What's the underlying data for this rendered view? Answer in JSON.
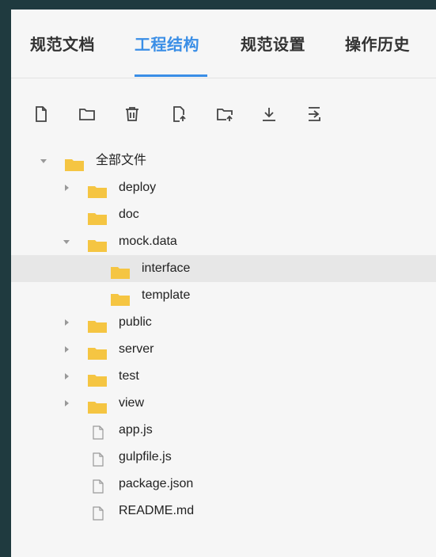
{
  "tabs": [
    {
      "label": "规范文档",
      "active": false
    },
    {
      "label": "工程结构",
      "active": true
    },
    {
      "label": "规范设置",
      "active": false
    },
    {
      "label": "操作历史",
      "active": false
    }
  ],
  "toolbar": [
    {
      "icon": "new-file-icon"
    },
    {
      "icon": "new-folder-icon"
    },
    {
      "icon": "delete-icon"
    },
    {
      "icon": "upload-file-icon"
    },
    {
      "icon": "upload-folder-icon"
    },
    {
      "icon": "download-icon"
    },
    {
      "icon": "export-icon"
    }
  ],
  "tree": {
    "root": {
      "label": "全部文件",
      "expanded": true
    },
    "items": [
      {
        "label": "deploy",
        "type": "folder",
        "expanded": false
      },
      {
        "label": "doc",
        "type": "folder",
        "expanded": null
      },
      {
        "label": "mock.data",
        "type": "folder",
        "expanded": true,
        "children": [
          {
            "label": "interface",
            "type": "folder",
            "selected": true
          },
          {
            "label": "template",
            "type": "folder"
          }
        ]
      },
      {
        "label": "public",
        "type": "folder",
        "expanded": false
      },
      {
        "label": "server",
        "type": "folder",
        "expanded": false
      },
      {
        "label": "test",
        "type": "folder",
        "expanded": false
      },
      {
        "label": "view",
        "type": "folder",
        "expanded": false
      },
      {
        "label": "app.js",
        "type": "file"
      },
      {
        "label": "gulpfile.js",
        "type": "file"
      },
      {
        "label": "package.json",
        "type": "file"
      },
      {
        "label": "README.md",
        "type": "file"
      }
    ]
  },
  "colors": {
    "accent": "#3a8ee6",
    "folder": "#f5c542",
    "selected_row": "#e7e7e7"
  }
}
